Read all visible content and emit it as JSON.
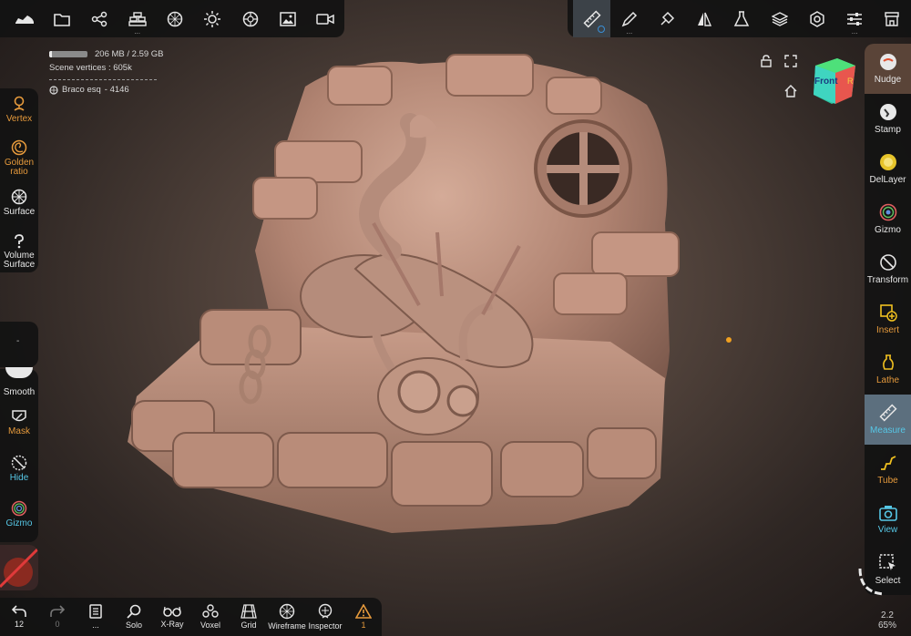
{
  "top_left_bar": {
    "items": [
      {
        "name": "shoe-icon"
      },
      {
        "name": "folder-icon"
      },
      {
        "name": "scene-graph-icon"
      },
      {
        "name": "stack-icon"
      },
      {
        "name": "material-sphere-icon"
      },
      {
        "name": "light-icon"
      },
      {
        "name": "environment-icon"
      },
      {
        "name": "image-icon"
      },
      {
        "name": "video-camera-icon"
      }
    ]
  },
  "top_right_bar": {
    "items": [
      {
        "name": "ruler-icon"
      },
      {
        "name": "brush-icon"
      },
      {
        "name": "paint-icon"
      },
      {
        "name": "symmetry-icon"
      },
      {
        "name": "flask-icon"
      },
      {
        "name": "layers-icon"
      },
      {
        "name": "settings-icon"
      },
      {
        "name": "sliders-icon"
      },
      {
        "name": "shop-icon"
      }
    ]
  },
  "info": {
    "memory_text": "206 MB / 2.59 GB",
    "memory_fraction": 0.08,
    "scene_vertices_label": "Scene vertices : ",
    "scene_vertices_value": "605k",
    "object_name": "Braco esq",
    "object_id": "- 4146"
  },
  "left_tools": {
    "vertex": "Vertex",
    "golden_ratio_1": "Golden",
    "golden_ratio_2": "ratio",
    "surface": "Surface",
    "volume_surface_1": "Volume",
    "volume_surface_2": "Surface",
    "smooth": "Smooth",
    "mask": "Mask",
    "hide": "Hide",
    "gizmo": "Gizmo",
    "slot_dash": "-"
  },
  "right_tools": [
    {
      "label": "Nudge",
      "icon": "nudge-icon"
    },
    {
      "label": "Stamp",
      "icon": "stamp-icon"
    },
    {
      "label": "DelLayer",
      "icon": "dellayer-icon"
    },
    {
      "label": "Gizmo",
      "icon": "gizmo-icon"
    },
    {
      "label": "Transform",
      "icon": "transform-icon"
    },
    {
      "label": "Insert",
      "icon": "insert-icon"
    },
    {
      "label": "Lathe",
      "icon": "lathe-icon"
    },
    {
      "label": "Measure",
      "icon": "measure-icon"
    },
    {
      "label": "Tube",
      "icon": "tube-icon"
    },
    {
      "label": "View",
      "icon": "view-icon"
    },
    {
      "label": "Select",
      "icon": "select-icon"
    }
  ],
  "bottom_bar": {
    "undo_count": "12",
    "redo_count": "0",
    "layers_label": "...",
    "solo": "Solo",
    "xray": "X-Ray",
    "voxel": "Voxel",
    "grid": "Grid",
    "wireframe": "Wireframe",
    "inspector": "Inspector",
    "warnings": "1"
  },
  "nav_cube": {
    "front_label": "Front",
    "right_label": "R"
  },
  "zoom": {
    "value": "2.2",
    "percent": "65%"
  },
  "colors": {
    "accent_orange": "#e69a3c",
    "accent_teal": "#56c7e6",
    "active_blue": "#5c6f7e",
    "clay": "#b58c7b"
  }
}
